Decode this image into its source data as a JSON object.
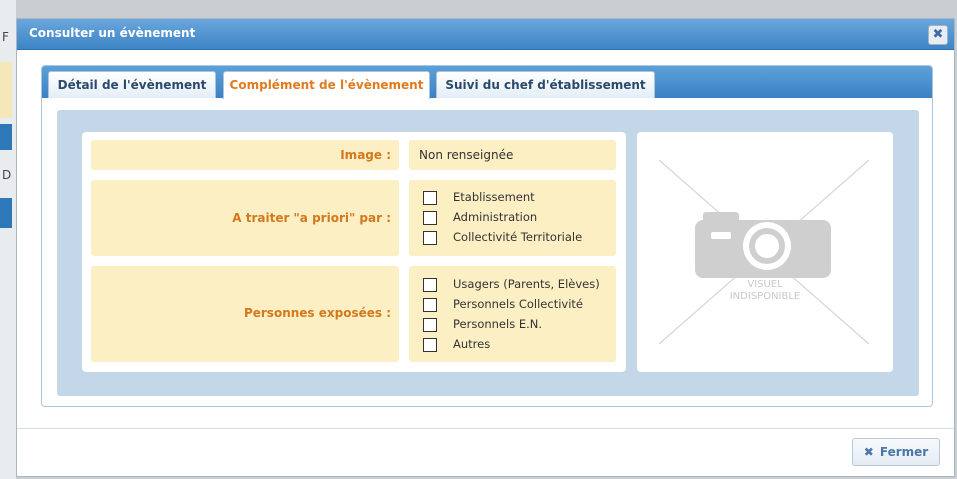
{
  "background": {
    "fragment_1": "F",
    "fragment_2": "D"
  },
  "dialog": {
    "title": "Consulter un évènement",
    "close_glyph": "✖"
  },
  "tabs": [
    {
      "label": "Détail de l'évènement",
      "active": false
    },
    {
      "label": "Complément de l'évènement",
      "active": true
    },
    {
      "label": "Suivi du chef d'établissement",
      "active": false
    }
  ],
  "form": {
    "image": {
      "label": "Image :",
      "value": "Non renseignée"
    },
    "a_traiter": {
      "label": "A traiter \"a priori\" par :",
      "options": [
        "Etablissement",
        "Administration",
        "Collectivité Territoriale"
      ],
      "checked": [
        false,
        false,
        false
      ]
    },
    "personnes": {
      "label": "Personnes exposées :",
      "options": [
        "Usagers (Parents, Elèves)",
        "Personnels Collectivité",
        "Personnels E.N.",
        "Autres"
      ],
      "checked": [
        false,
        false,
        false,
        false
      ]
    }
  },
  "placeholder": {
    "line1": "VISUEL",
    "line2": "INDISPONIBLE"
  },
  "footer": {
    "close_button_glyph": "✖",
    "close_button_label": "Fermer"
  }
}
